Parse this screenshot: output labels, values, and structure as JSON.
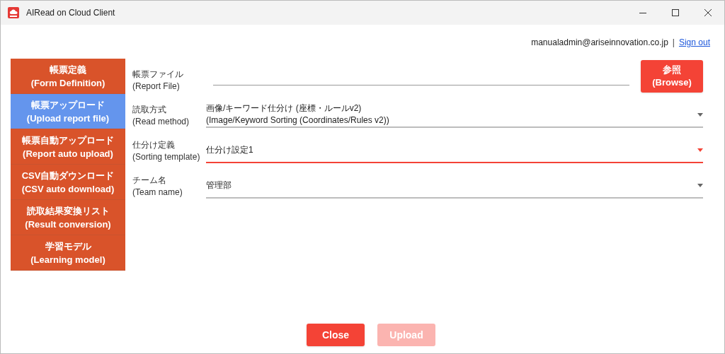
{
  "window": {
    "title": "AIRead on Cloud Client"
  },
  "user": {
    "email": "manualadmin@ariseinnovation.co.jp",
    "separator": "|",
    "sign_out": "Sign out"
  },
  "sidebar": {
    "items": [
      {
        "label": "帳票定義",
        "sublabel": "(Form Definition)",
        "selected": false
      },
      {
        "label": "帳票アップロード",
        "sublabel": "(Upload report file)",
        "selected": true
      },
      {
        "label": "帳票自動アップロード",
        "sublabel": "(Report auto upload)",
        "selected": false
      },
      {
        "label": "CSV自動ダウンロード",
        "sublabel": "(CSV auto download)",
        "selected": false
      },
      {
        "label": "読取結果変換リスト",
        "sublabel": "(Result conversion)",
        "selected": false
      },
      {
        "label": "学習モデル",
        "sublabel": "(Learning model)",
        "selected": false
      }
    ]
  },
  "form": {
    "fields": [
      {
        "kind": "file",
        "label": "帳票ファイル",
        "sublabel": "(Report File)",
        "button": {
          "label": "参照",
          "sublabel": "(Browse)"
        },
        "focused": false
      },
      {
        "kind": "select",
        "label": "読取方式",
        "sublabel": "(Read method)",
        "value": "画像/キーワード仕分け (座標・ルールv2)",
        "value_sub": "(Image/Keyword Sorting (Coordinates/Rules v2))",
        "focused": false
      },
      {
        "kind": "select",
        "label": "仕分け定義",
        "sublabel": "(Sorting template)",
        "value": "仕分け設定1",
        "focused": true
      },
      {
        "kind": "select",
        "label": "チーム名",
        "sublabel": "(Team name)",
        "value": "管理部",
        "focused": false
      }
    ]
  },
  "buttons": [
    {
      "label": "Close",
      "disabled": false
    },
    {
      "label": "Upload",
      "disabled": true
    }
  ]
}
